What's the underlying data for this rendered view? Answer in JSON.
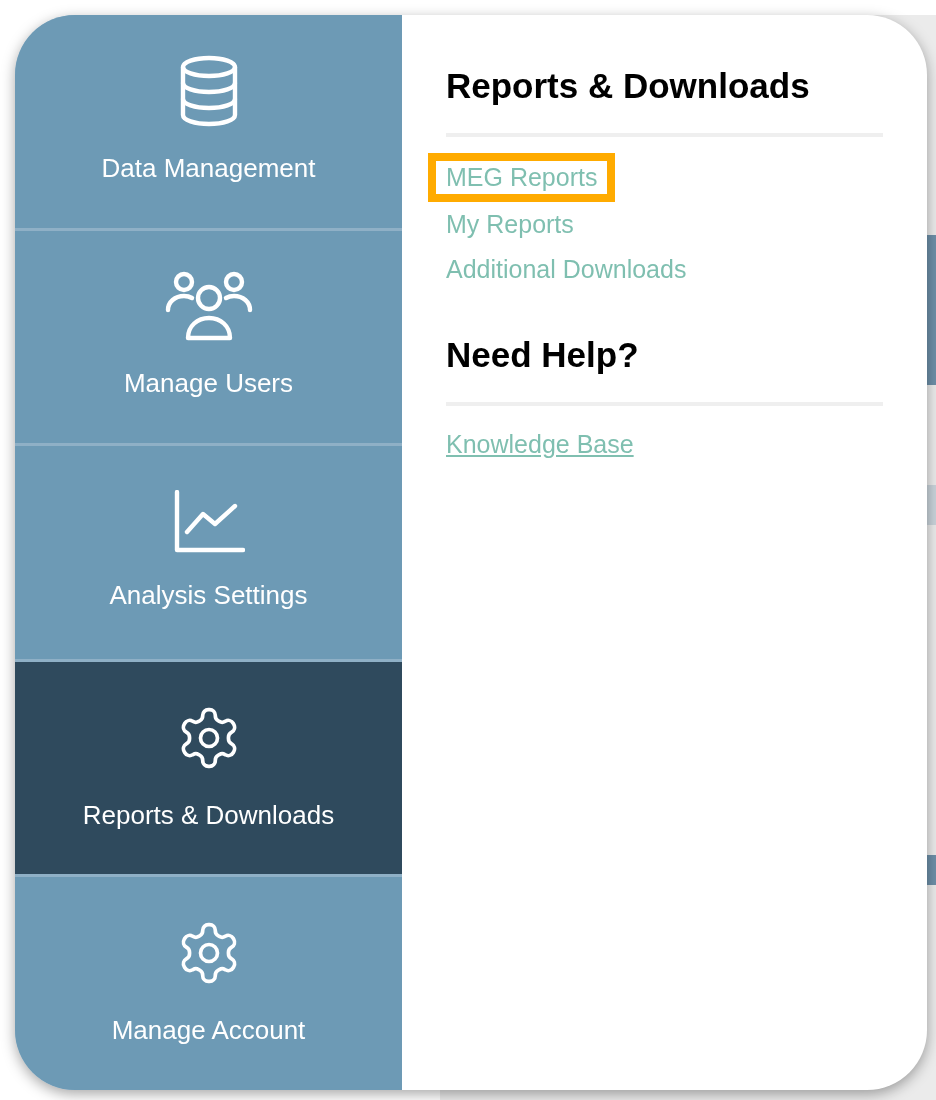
{
  "nav_items": [
    {
      "label": "Data Management",
      "kind": "database",
      "selected": false
    },
    {
      "label": "Manage Users",
      "kind": "users",
      "selected": false
    },
    {
      "label": "Analysis Settings",
      "kind": "chart",
      "selected": false
    },
    {
      "label": "Reports & Downloads",
      "kind": "gear",
      "selected": true
    },
    {
      "label": "Manage Account",
      "kind": "gear",
      "selected": false
    }
  ],
  "sections": [
    {
      "heading": "Reports & Downloads",
      "links": [
        {
          "label": "MEG Reports",
          "highlighted": true,
          "underlined": false
        },
        {
          "label": "My Reports",
          "highlighted": false,
          "underlined": false
        },
        {
          "label": "Additional Downloads",
          "highlighted": false,
          "underlined": false
        }
      ]
    },
    {
      "heading": "Need Help?",
      "links": [
        {
          "label": "Knowledge Base",
          "highlighted": false,
          "underlined": true
        }
      ]
    }
  ]
}
